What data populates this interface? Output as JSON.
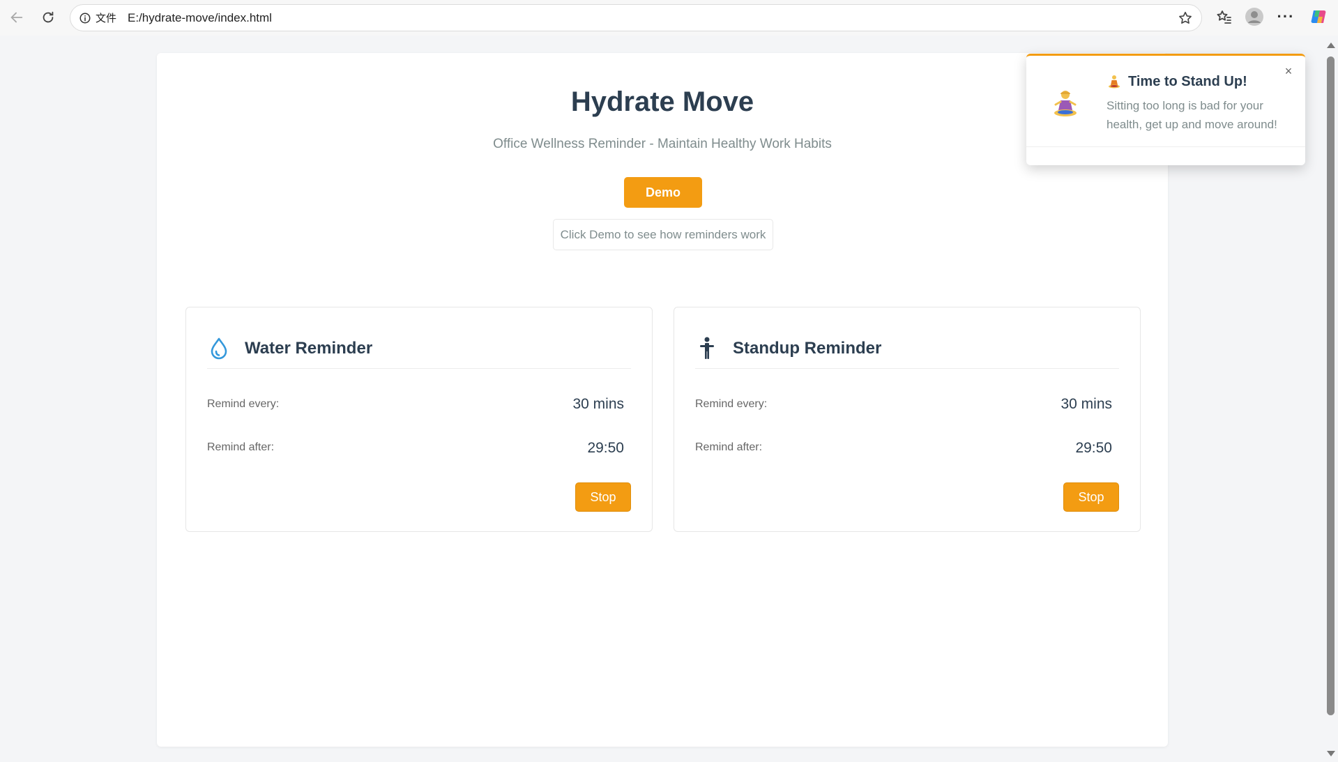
{
  "browser": {
    "address_label": "文件",
    "url": "E:/hydrate-move/index.html"
  },
  "page": {
    "title": "Hydrate Move",
    "subtitle": "Office Wellness Reminder - Maintain Healthy Work Habits",
    "demo_label": "Demo",
    "hint": "Click Demo to see how reminders work"
  },
  "cards": [
    {
      "icon": "water-drop-icon",
      "title": "Water Reminder",
      "every_label": "Remind every:",
      "every_value": "30 mins",
      "after_label": "Remind after:",
      "after_value": "29:50",
      "button_label": "Stop"
    },
    {
      "icon": "standing-person-icon",
      "title": "Standup Reminder",
      "every_label": "Remind every:",
      "every_value": "30 mins",
      "after_label": "Remind after:",
      "after_value": "29:50",
      "button_label": "Stop"
    }
  ],
  "toast": {
    "title": "Time to Stand Up!",
    "message": "Sitting too long is bad for your health, get up and move around!",
    "close": "×",
    "icon": "person-in-lotus-position-icon"
  },
  "colors": {
    "accent": "#f39c12",
    "heading": "#2c3e50",
    "muted": "#7f8c8d",
    "water_icon": "#3498db"
  }
}
